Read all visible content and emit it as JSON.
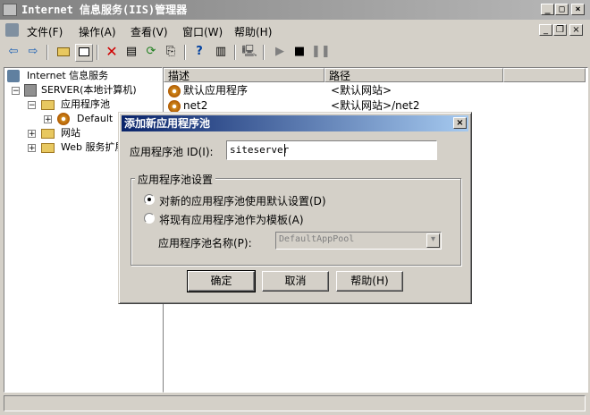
{
  "window": {
    "title": "Internet 信息服务(IIS)管理器",
    "min_glyph": "_",
    "max_glyph": "□",
    "close_glyph": "×",
    "child_min_glyph": "_",
    "child_restore_glyph": "❐",
    "child_close_glyph": "×"
  },
  "menu": [
    "文件(F)",
    "操作(A)",
    "查看(V)",
    "窗口(W)",
    "帮助(H)"
  ],
  "tree": {
    "root": "Internet 信息服务",
    "server": "SERVER(本地计算机)",
    "app_pools": "应用程序池",
    "default_pool": "Default",
    "websites": "网站",
    "web_ext": "Web 服务扩展"
  },
  "list": {
    "headers": [
      "描述",
      "路径"
    ],
    "rows": [
      {
        "name": "默认应用程序",
        "path": "<默认网站>"
      },
      {
        "name": "net2",
        "path": "<默认网站>/net2"
      }
    ]
  },
  "dialog": {
    "title": "添加新应用程序池",
    "close_glyph": "×",
    "id_label": "应用程序池 ID(I):",
    "id_value": "siteserver",
    "group_label": "应用程序池设置",
    "radio_default": "对新的应用程序池使用默认设置(D)",
    "radio_template": "将现有应用程序池作为模板(A)",
    "pool_name_label": "应用程序池名称(P):",
    "pool_name_value": "DefaultAppPool",
    "ok": "确定",
    "cancel": "取消",
    "help": "帮助(H)"
  },
  "toolbar_icons": [
    "back-arrow",
    "forward-arrow",
    "up-folder",
    "show-tree",
    "delete",
    "properties",
    "refresh",
    "export",
    "help",
    "console-tree",
    "computer",
    "play",
    "stop",
    "pause"
  ]
}
